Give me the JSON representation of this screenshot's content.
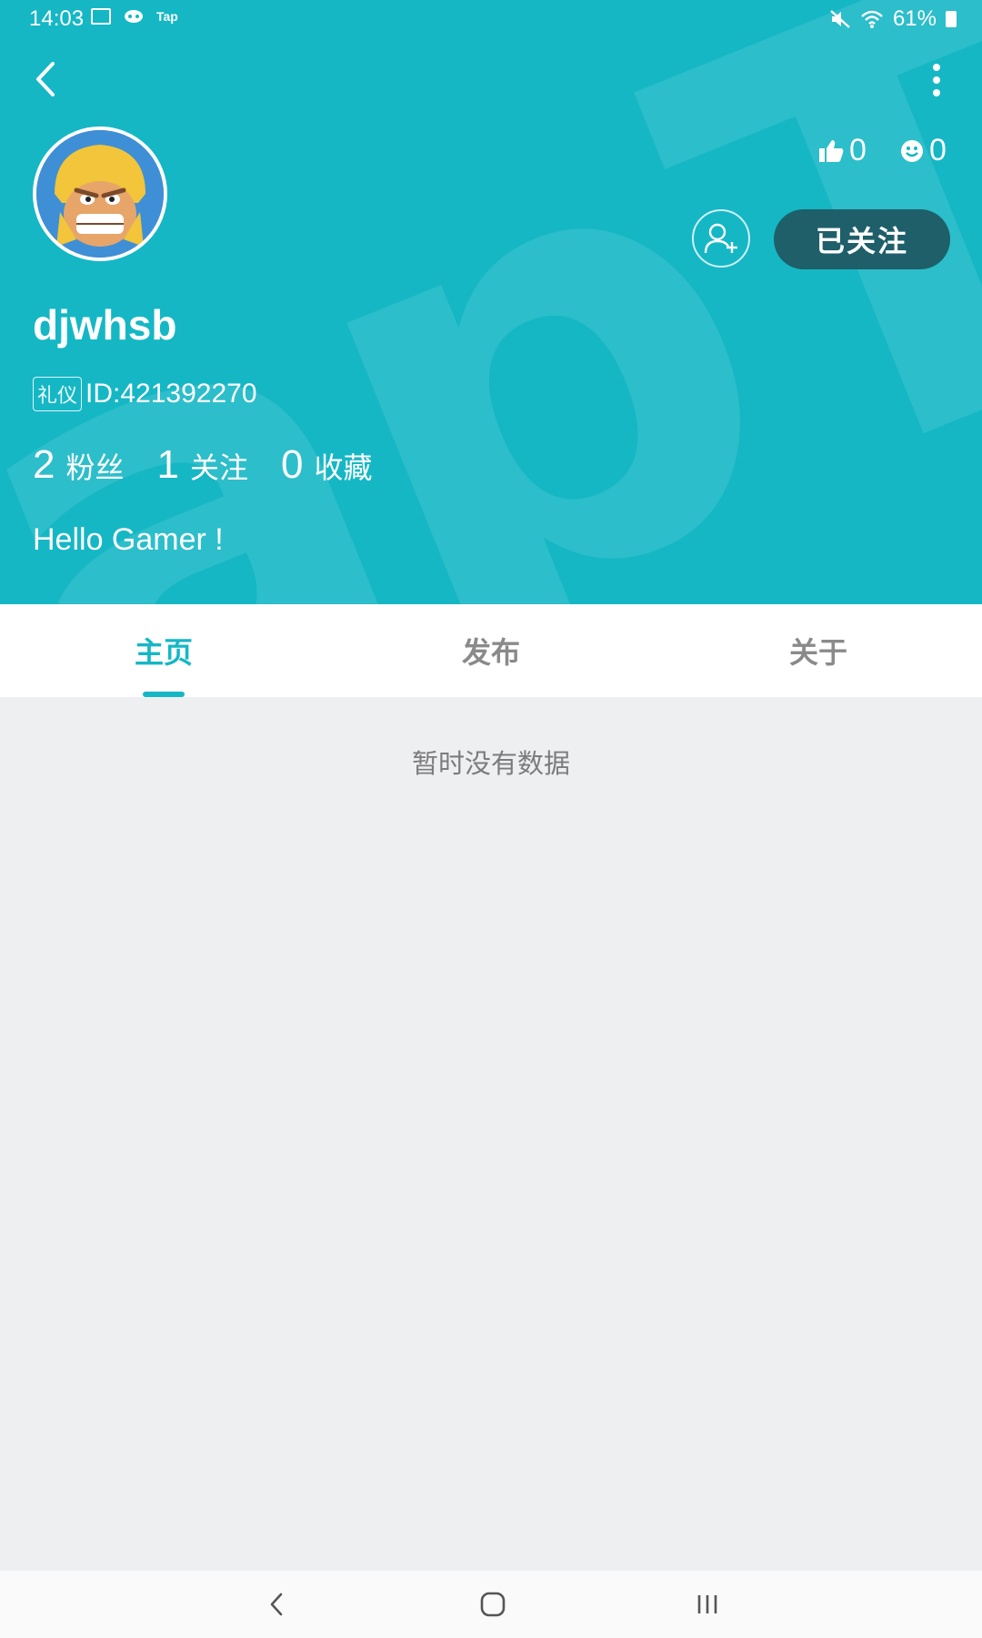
{
  "status_bar": {
    "time": "14:03",
    "tap_label": "Tap",
    "battery_percent": "61%"
  },
  "header": {
    "bg_color": "#15b7c5",
    "watermark_text": "apTa",
    "likes": "0",
    "smiles": "0",
    "follow_label": "已关注",
    "username": "djwhsb",
    "badge": "礼仪",
    "user_id": "ID:421392270",
    "counts": [
      {
        "num": "2",
        "label": "粉丝"
      },
      {
        "num": "1",
        "label": "关注"
      },
      {
        "num": "0",
        "label": "收藏"
      }
    ],
    "bio": "Hello Gamer !"
  },
  "tabs": [
    {
      "label": "主页",
      "active": true
    },
    {
      "label": "发布",
      "active": false
    },
    {
      "label": "关于",
      "active": false
    }
  ],
  "empty_message": "暂时没有数据",
  "icons": {
    "back": "chevron-left-icon",
    "more": "more-vertical-icon",
    "like": "thumbs-up-icon",
    "smile": "smile-icon",
    "add_friend": "add-user-icon"
  }
}
